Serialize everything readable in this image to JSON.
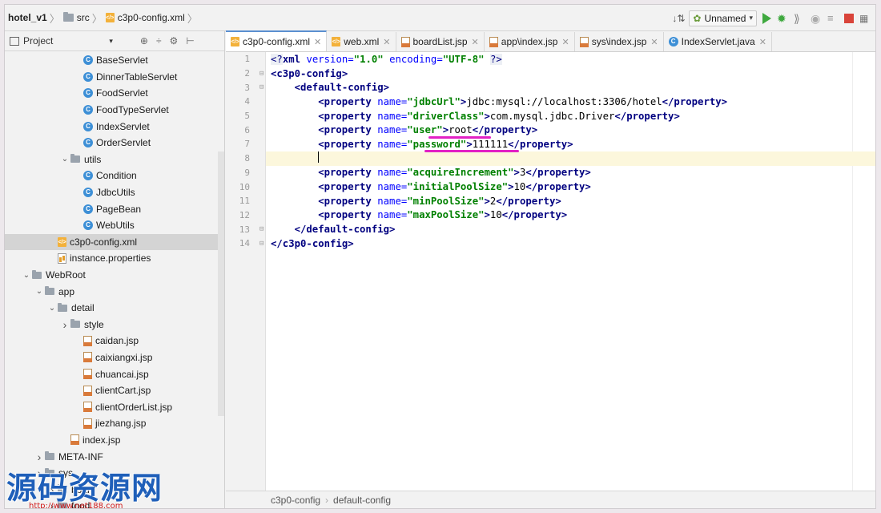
{
  "breadcrumb": {
    "project": "hotel_v1",
    "folder": "src",
    "file": "c3p0-config.xml"
  },
  "toolbar": {
    "run_config": "Unnamed"
  },
  "project_panel": {
    "title": "Project",
    "tree": [
      {
        "label": "BaseServlet",
        "icon": "class",
        "indent": 5,
        "arrow": ""
      },
      {
        "label": "DinnerTableServlet",
        "icon": "class",
        "indent": 5,
        "arrow": ""
      },
      {
        "label": "FoodServlet",
        "icon": "class",
        "indent": 5,
        "arrow": ""
      },
      {
        "label": "FoodTypeServlet",
        "icon": "class",
        "indent": 5,
        "arrow": ""
      },
      {
        "label": "IndexServlet",
        "icon": "class",
        "indent": 5,
        "arrow": ""
      },
      {
        "label": "OrderServlet",
        "icon": "class",
        "indent": 5,
        "arrow": ""
      },
      {
        "label": "utils",
        "icon": "folder",
        "indent": 4,
        "arrow": "v"
      },
      {
        "label": "Condition",
        "icon": "class",
        "indent": 5,
        "arrow": ""
      },
      {
        "label": "JdbcUtils",
        "icon": "class",
        "indent": 5,
        "arrow": ""
      },
      {
        "label": "PageBean",
        "icon": "class",
        "indent": 5,
        "arrow": ""
      },
      {
        "label": "WebUtils",
        "icon": "class",
        "indent": 5,
        "arrow": ""
      },
      {
        "label": "c3p0-config.xml",
        "icon": "xml",
        "indent": 3,
        "arrow": "",
        "selected": true
      },
      {
        "label": "instance.properties",
        "icon": "props",
        "indent": 3,
        "arrow": ""
      },
      {
        "label": "WebRoot",
        "icon": "folder",
        "indent": 1,
        "arrow": "v"
      },
      {
        "label": "app",
        "icon": "folder",
        "indent": 2,
        "arrow": "v"
      },
      {
        "label": "detail",
        "icon": "folder",
        "indent": 3,
        "arrow": "v"
      },
      {
        "label": "style",
        "icon": "folder",
        "indent": 4,
        "arrow": ">"
      },
      {
        "label": "caidan.jsp",
        "icon": "jsp",
        "indent": 5,
        "arrow": ""
      },
      {
        "label": "caixiangxi.jsp",
        "icon": "jsp",
        "indent": 5,
        "arrow": ""
      },
      {
        "label": "chuancai.jsp",
        "icon": "jsp",
        "indent": 5,
        "arrow": ""
      },
      {
        "label": "clientCart.jsp",
        "icon": "jsp",
        "indent": 5,
        "arrow": ""
      },
      {
        "label": "clientOrderList.jsp",
        "icon": "jsp",
        "indent": 5,
        "arrow": ""
      },
      {
        "label": "jiezhang.jsp",
        "icon": "jsp",
        "indent": 5,
        "arrow": ""
      },
      {
        "label": "index.jsp",
        "icon": "jsp",
        "indent": 4,
        "arrow": ""
      },
      {
        "label": "META-INF",
        "icon": "folder",
        "indent": 2,
        "arrow": ">"
      },
      {
        "label": "sys",
        "icon": "folder",
        "indent": 2,
        "arrow": ">"
      },
      {
        "label": "board",
        "icon": "folder",
        "indent": 3,
        "arrow": ">"
      },
      {
        "label": "food",
        "icon": "folder",
        "indent": 3,
        "arrow": ">"
      }
    ]
  },
  "tabs": [
    {
      "label": "c3p0-config.xml",
      "icon": "xml",
      "active": true
    },
    {
      "label": "web.xml",
      "icon": "xml",
      "active": false
    },
    {
      "label": "boardList.jsp",
      "icon": "jsp",
      "active": false
    },
    {
      "label": "app\\index.jsp",
      "icon": "jsp",
      "active": false
    },
    {
      "label": "sys\\index.jsp",
      "icon": "jsp",
      "active": false
    },
    {
      "label": "IndexServlet.java",
      "icon": "java",
      "active": false
    }
  ],
  "code_lines": [
    {
      "n": "1",
      "parts": [
        [
          "pi",
          "<?"
        ],
        [
          "tag",
          "xml "
        ],
        [
          "attr",
          "version="
        ],
        [
          "val",
          "\"1.0\" "
        ],
        [
          "attr",
          "encoding="
        ],
        [
          "val",
          "\"UTF-8\" "
        ],
        [
          "pi",
          "?>"
        ]
      ],
      "indent": 0
    },
    {
      "n": "2",
      "parts": [
        [
          "tag",
          "<c3p0-config>"
        ]
      ],
      "indent": 0
    },
    {
      "n": "3",
      "parts": [
        [
          "tag",
          "<default-config>"
        ]
      ],
      "indent": 4
    },
    {
      "n": "4",
      "parts": [
        [
          "tag",
          "<property "
        ],
        [
          "attr",
          "name="
        ],
        [
          "val",
          "\"jdbcUrl\""
        ],
        [
          "tag",
          ">"
        ],
        [
          "txt",
          "jdbc:mysql://localhost:3306/hotel"
        ],
        [
          "tag",
          "</property>"
        ]
      ],
      "indent": 8
    },
    {
      "n": "5",
      "parts": [
        [
          "tag",
          "<property "
        ],
        [
          "attr",
          "name="
        ],
        [
          "val",
          "\"driverClass\""
        ],
        [
          "tag",
          ">"
        ],
        [
          "txt",
          "com.mysql.jdbc.Driver"
        ],
        [
          "tag",
          "</property>"
        ]
      ],
      "indent": 8
    },
    {
      "n": "6",
      "parts": [
        [
          "tag",
          "<property "
        ],
        [
          "attr",
          "name="
        ],
        [
          "val",
          "\"user\""
        ],
        [
          "tag",
          ">"
        ],
        [
          "txt",
          "root"
        ],
        [
          "tag",
          "</property>"
        ]
      ],
      "indent": 8
    },
    {
      "n": "7",
      "parts": [
        [
          "tag",
          "<property "
        ],
        [
          "attr",
          "name="
        ],
        [
          "val",
          "\"password\""
        ],
        [
          "tag",
          ">"
        ],
        [
          "txt",
          "111111"
        ],
        [
          "tag",
          "</property>"
        ]
      ],
      "indent": 8
    },
    {
      "n": "8",
      "parts": [],
      "indent": 8,
      "current": true
    },
    {
      "n": "9",
      "parts": [
        [
          "tag",
          "<property "
        ],
        [
          "attr",
          "name="
        ],
        [
          "val",
          "\"acquireIncrement\""
        ],
        [
          "tag",
          ">"
        ],
        [
          "txt",
          "3"
        ],
        [
          "tag",
          "</property>"
        ]
      ],
      "indent": 8
    },
    {
      "n": "10",
      "parts": [
        [
          "tag",
          "<property "
        ],
        [
          "attr",
          "name="
        ],
        [
          "val",
          "\"initialPoolSize\""
        ],
        [
          "tag",
          ">"
        ],
        [
          "txt",
          "10"
        ],
        [
          "tag",
          "</property>"
        ]
      ],
      "indent": 8
    },
    {
      "n": "11",
      "parts": [
        [
          "tag",
          "<property "
        ],
        [
          "attr",
          "name="
        ],
        [
          "val",
          "\"minPoolSize\""
        ],
        [
          "tag",
          ">"
        ],
        [
          "txt",
          "2"
        ],
        [
          "tag",
          "</property>"
        ]
      ],
      "indent": 8
    },
    {
      "n": "12",
      "parts": [
        [
          "tag",
          "<property "
        ],
        [
          "attr",
          "name="
        ],
        [
          "val",
          "\"maxPoolSize\""
        ],
        [
          "tag",
          ">"
        ],
        [
          "txt",
          "10"
        ],
        [
          "tag",
          "</property>"
        ]
      ],
      "indent": 8
    },
    {
      "n": "13",
      "parts": [
        [
          "tag",
          "</default-config>"
        ]
      ],
      "indent": 4
    },
    {
      "n": "14",
      "parts": [
        [
          "tag",
          "</c3p0-config>"
        ]
      ],
      "indent": 0
    }
  ],
  "statusbar": {
    "crumb1": "c3p0-config",
    "crumb2": "default-config"
  },
  "watermark": {
    "big": "源码资源网",
    "small": "http://www.net188.com"
  },
  "colors": {
    "tag": "#000080",
    "attr": "#0000ff",
    "value": "#008000",
    "annotation": "#e221c5",
    "current_line": "#fcf7dc"
  }
}
